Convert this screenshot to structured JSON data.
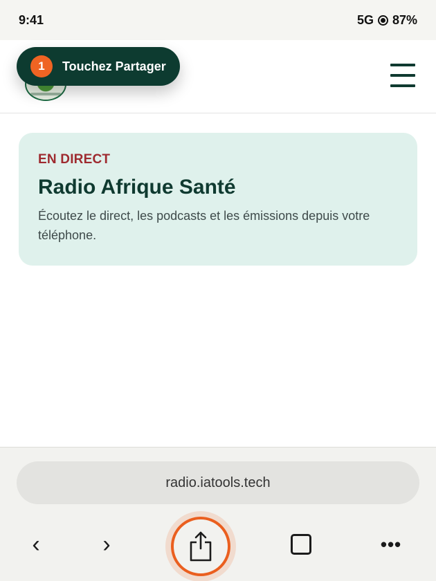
{
  "status_bar": {
    "time": "9:41",
    "network": "5G",
    "battery": "87%"
  },
  "header": {
    "logo_icon": "radio-logo-icon",
    "menu_icon": "hamburger-menu-icon"
  },
  "hint": {
    "step": "1",
    "text": "Touchez Partager"
  },
  "hero": {
    "live_label": "EN DIRECT",
    "title": "Radio Afrique Santé",
    "description": "Écoutez le direct, les podcasts et les émissions depuis votre téléphone."
  },
  "browser": {
    "url": "radio.iatools.tech",
    "back_glyph": "‹",
    "forward_glyph": "›",
    "share_icon": "share-icon",
    "tabs_icon": "tabs-icon",
    "more_glyph": "•••"
  },
  "colors": {
    "accent": "#ef6423",
    "brand_dark": "#0d3b30",
    "live_red": "#9e2a2f",
    "card_bg": "#dff1ec"
  }
}
